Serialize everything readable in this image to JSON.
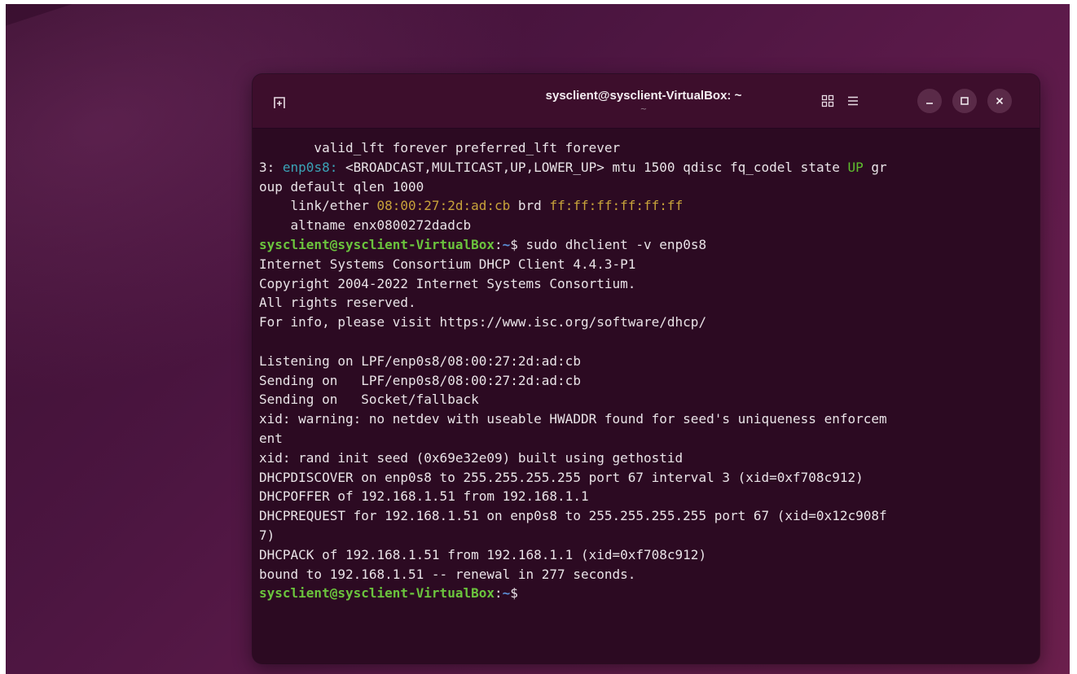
{
  "window": {
    "title": "sysclient@sysclient-VirtualBox: ~",
    "subtitle": "~"
  },
  "icons": {
    "new_tab": "new-tab-icon",
    "grid": "grid-view-icon",
    "menu": "hamburger-menu-icon",
    "minimize": "minimize-icon",
    "maximize": "maximize-icon",
    "close": "close-icon"
  },
  "colors": {
    "prompt_user": "#6bc43d",
    "prompt_path": "#5b8fd6",
    "interface": "#3aa3b7",
    "state_up": "#5fbf2e",
    "mac_address": "#c7a23a",
    "terminal_bg": "#2c0a22",
    "titlebar_bg": "#3d0e2c"
  },
  "terminal": {
    "line1": "       valid_lft forever preferred_lft forever",
    "line2": {
      "prefix": "3: ",
      "iface": "enp0s8:",
      "mid": " <BROADCAST,MULTICAST,UP,LOWER_UP> mtu 1500 qdisc fq_codel state ",
      "state": "UP",
      "suffix": " gr"
    },
    "line3": "oup default qlen 1000",
    "line4": {
      "prefix": "    link/ether ",
      "mac": "08:00:27:2d:ad:cb",
      "mid": " brd ",
      "brd": "ff:ff:ff:ff:ff:ff"
    },
    "line5": "    altname enx0800272dadcb",
    "prompt1": {
      "user": "sysclient@sysclient-VirtualBox",
      "sep": ":",
      "path": "~",
      "dollar": "$",
      "command": " sudo dhclient -v enp0s8"
    },
    "output": [
      "Internet Systems Consortium DHCP Client 4.4.3-P1",
      "Copyright 2004-2022 Internet Systems Consortium.",
      "All rights reserved.",
      "For info, please visit https://www.isc.org/software/dhcp/",
      "",
      "Listening on LPF/enp0s8/08:00:27:2d:ad:cb",
      "Sending on   LPF/enp0s8/08:00:27:2d:ad:cb",
      "Sending on   Socket/fallback",
      "xid: warning: no netdev with useable HWADDR found for seed's uniqueness enforcem",
      "ent",
      "xid: rand init seed (0x69e32e09) built using gethostid",
      "DHCPDISCOVER on enp0s8 to 255.255.255.255 port 67 interval 3 (xid=0xf708c912)",
      "DHCPOFFER of 192.168.1.51 from 192.168.1.1",
      "DHCPREQUEST for 192.168.1.51 on enp0s8 to 255.255.255.255 port 67 (xid=0x12c908f",
      "7)",
      "DHCPACK of 192.168.1.51 from 192.168.1.1 (xid=0xf708c912)",
      "bound to 192.168.1.51 -- renewal in 277 seconds."
    ],
    "prompt2": {
      "user": "sysclient@sysclient-VirtualBox",
      "sep": ":",
      "path": "~",
      "dollar": "$"
    }
  }
}
